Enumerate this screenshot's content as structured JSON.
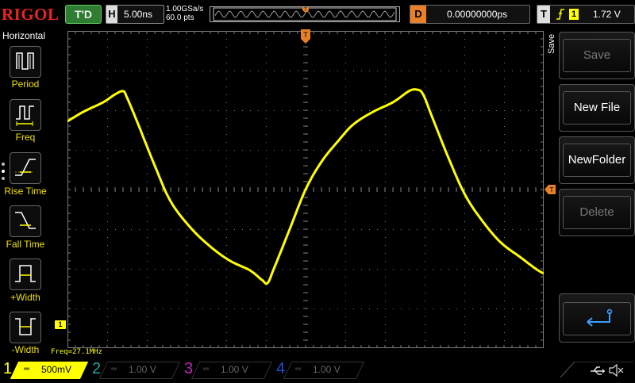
{
  "brand": "RIGOL",
  "status": {
    "run_state": "T'D"
  },
  "horizontal": {
    "label": "H",
    "timebase": "5.00ns",
    "sample_rate": "1.00GSa/s",
    "points": "60.0 pts"
  },
  "delay": {
    "label": "D",
    "value": "0.00000000ps"
  },
  "trigger": {
    "label": "T",
    "source": "1",
    "level": "1.72 V"
  },
  "left_menu": {
    "title": "Horizontal",
    "items": [
      {
        "label": "Period",
        "icon": "period-icon"
      },
      {
        "label": "Freq",
        "icon": "freq-icon"
      },
      {
        "label": "Rise Time",
        "icon": "rise-time-icon"
      },
      {
        "label": "Fall Time",
        "icon": "fall-time-icon"
      },
      {
        "label": "+Width",
        "icon": "positive-width-icon"
      },
      {
        "label": "-Width",
        "icon": "negative-width-icon"
      }
    ]
  },
  "screen": {
    "trigger_marker": "T",
    "channel_marker": "1",
    "measurement": "Freq=27.1MHz"
  },
  "right_menu": {
    "tab": "Save",
    "buttons": [
      {
        "label": "Save",
        "enabled": false
      },
      {
        "label": "New File",
        "enabled": true
      },
      {
        "label": "NewFolder",
        "enabled": true
      },
      {
        "label": "Delete",
        "enabled": false
      }
    ]
  },
  "channels": [
    {
      "num": "1",
      "scale": "500mV",
      "active": true,
      "color": "#ffff00"
    },
    {
      "num": "2",
      "scale": "1.00 V",
      "active": false,
      "color": "#20a0a0"
    },
    {
      "num": "3",
      "scale": "1.00 V",
      "active": false,
      "color": "#c020c0"
    },
    {
      "num": "4",
      "scale": "1.00 V",
      "active": false,
      "color": "#2050d0"
    }
  ],
  "colors": {
    "trace": "#ffff00",
    "trigger": "#e8802a",
    "grid": "#7a7a7a",
    "logo": "#e22222"
  }
}
